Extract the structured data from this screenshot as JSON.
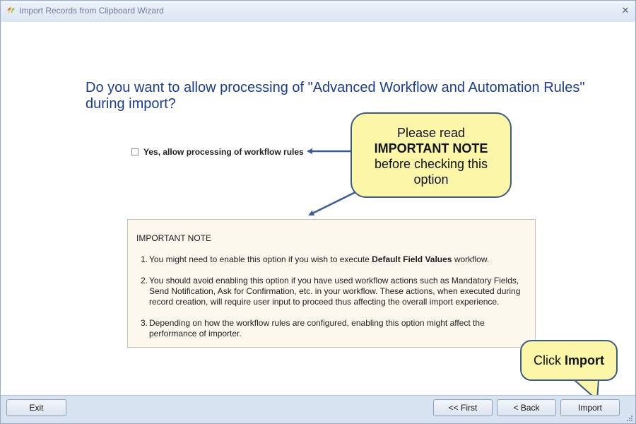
{
  "window": {
    "title": "Import Records from Clipboard Wizard",
    "icon": "app-logo-icon",
    "close_label": "✕"
  },
  "main": {
    "question": "Do you want to allow processing of \"Advanced Workflow and Automation Rules\" during import?",
    "option": {
      "label": "Yes, allow processing of workflow rules",
      "checked": false
    }
  },
  "callout": {
    "line1": "Please read",
    "line2": "IMPORTANT NOTE",
    "line3": "before checking this",
    "line4": "option",
    "fill_color": "#fbf6a8",
    "border_color": "#3d5a80"
  },
  "note": {
    "title": "IMPORTANT NOTE",
    "items": [
      {
        "num": "1.",
        "pre": "You might need to enable this option if you wish to execute ",
        "bold": "Default Field Values",
        "post": " workflow."
      },
      {
        "num": "2.",
        "text": "You should avoid enabling this option if  you have used workflow actions such as Mandatory Fields, Send Notification, Ask for Confirmation, etc. in your workflow. These actions, when executed during record creation, will require user input to proceed thus affecting the overall import experience."
      },
      {
        "num": "3.",
        "text": "Depending on how the workflow rules are configured, enabling this option might affect the performance of importer."
      }
    ]
  },
  "callout2": {
    "pre": "Click ",
    "bold": "Import"
  },
  "footer": {
    "exit": "Exit",
    "first": "<< First",
    "back": "< Back",
    "import": "Import"
  },
  "colors": {
    "question_text": "#1c3d8c",
    "arrow": "#3a5a9a",
    "toolbar_bg": "#d8e3f1"
  }
}
